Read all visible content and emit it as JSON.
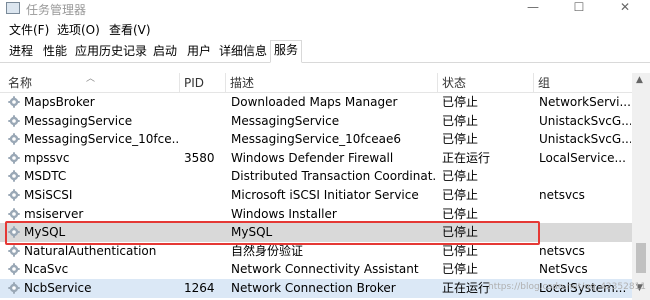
{
  "window": {
    "title": "任务管理器",
    "minimize": "—",
    "maximize": "☐",
    "close": "✕"
  },
  "menu": [
    "文件(F)",
    "选项(O)",
    "查看(V)"
  ],
  "tabs": [
    "进程",
    "性能",
    "应用历史记录",
    "启动",
    "用户",
    "详细信息",
    "服务"
  ],
  "active_tab": "服务",
  "columns": {
    "name": "名称",
    "pid": "PID",
    "desc": "描述",
    "status": "状态",
    "group": "组"
  },
  "rows": [
    {
      "name": "MapsBroker",
      "pid": "",
      "desc": "Downloaded Maps Manager",
      "status": "已停止",
      "group": "NetworkServi..."
    },
    {
      "name": "MessagingService",
      "pid": "",
      "desc": "MessagingService",
      "status": "已停止",
      "group": "UnistackSvcG..."
    },
    {
      "name": "MessagingService_10fce...",
      "pid": "",
      "desc": "MessagingService_10fceae6",
      "status": "已停止",
      "group": "UnistackSvcG..."
    },
    {
      "name": "mpssvc",
      "pid": "3580",
      "desc": "Windows Defender Firewall",
      "status": "正在运行",
      "group": "LocalService..."
    },
    {
      "name": "MSDTC",
      "pid": "",
      "desc": "Distributed Transaction Coordinat...",
      "status": "已停止",
      "group": ""
    },
    {
      "name": "MSiSCSI",
      "pid": "",
      "desc": "Microsoft iSCSI Initiator Service",
      "status": "已停止",
      "group": "netsvcs"
    },
    {
      "name": "msiserver",
      "pid": "",
      "desc": "Windows Installer",
      "status": "已停止",
      "group": ""
    },
    {
      "name": "MySQL",
      "pid": "",
      "desc": "MySQL",
      "status": "已停止",
      "group": ""
    },
    {
      "name": "NaturalAuthentication",
      "pid": "",
      "desc": "自然身份验证",
      "status": "已停止",
      "group": "netsvcs"
    },
    {
      "name": "NcaSvc",
      "pid": "",
      "desc": "Network Connectivity Assistant",
      "status": "已停止",
      "group": "NetSvcs"
    },
    {
      "name": "NcbService",
      "pid": "1264",
      "desc": "Network Connection Broker",
      "status": "正在运行",
      "group": "LocalSystem..."
    }
  ],
  "selected_row_index": 7,
  "watermark": "https://blog.csdn.net/qq_42352811",
  "colors": {
    "highlight_border": "#e53935",
    "selected_row": "#d9d9d9"
  }
}
